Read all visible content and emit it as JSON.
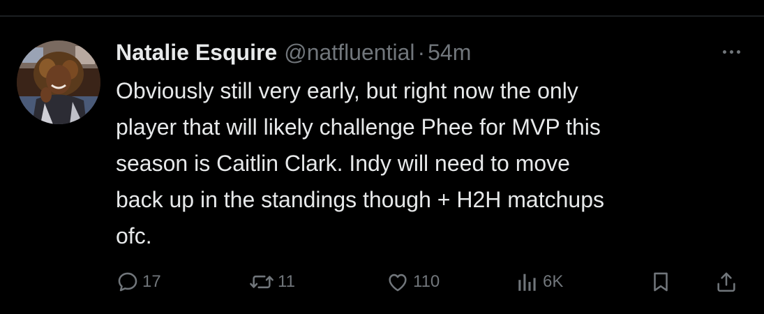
{
  "tweet": {
    "author": {
      "display_name": "Natalie Esquire",
      "handle": "@natfluential",
      "separator": "·",
      "time": "54m"
    },
    "text": "Obviously still very early, but right now the only\nplayer that will likely challenge Phee for MVP this\nseason is Caitlin Clark. Indy will need to move\nback up in the standings though + H2H matchups\nofc.",
    "actions": {
      "replies": "17",
      "reposts": "11",
      "likes": "110",
      "views": "6K"
    }
  },
  "icons": {
    "reply": "reply-icon",
    "repost": "repost-icon",
    "like": "heart-icon",
    "views": "views-chart-icon",
    "bookmark": "bookmark-icon",
    "share": "share-icon",
    "more": "more-dots-icon"
  },
  "colors": {
    "background": "#000000",
    "text_primary": "#e7e9ea",
    "text_secondary": "#71767b"
  }
}
